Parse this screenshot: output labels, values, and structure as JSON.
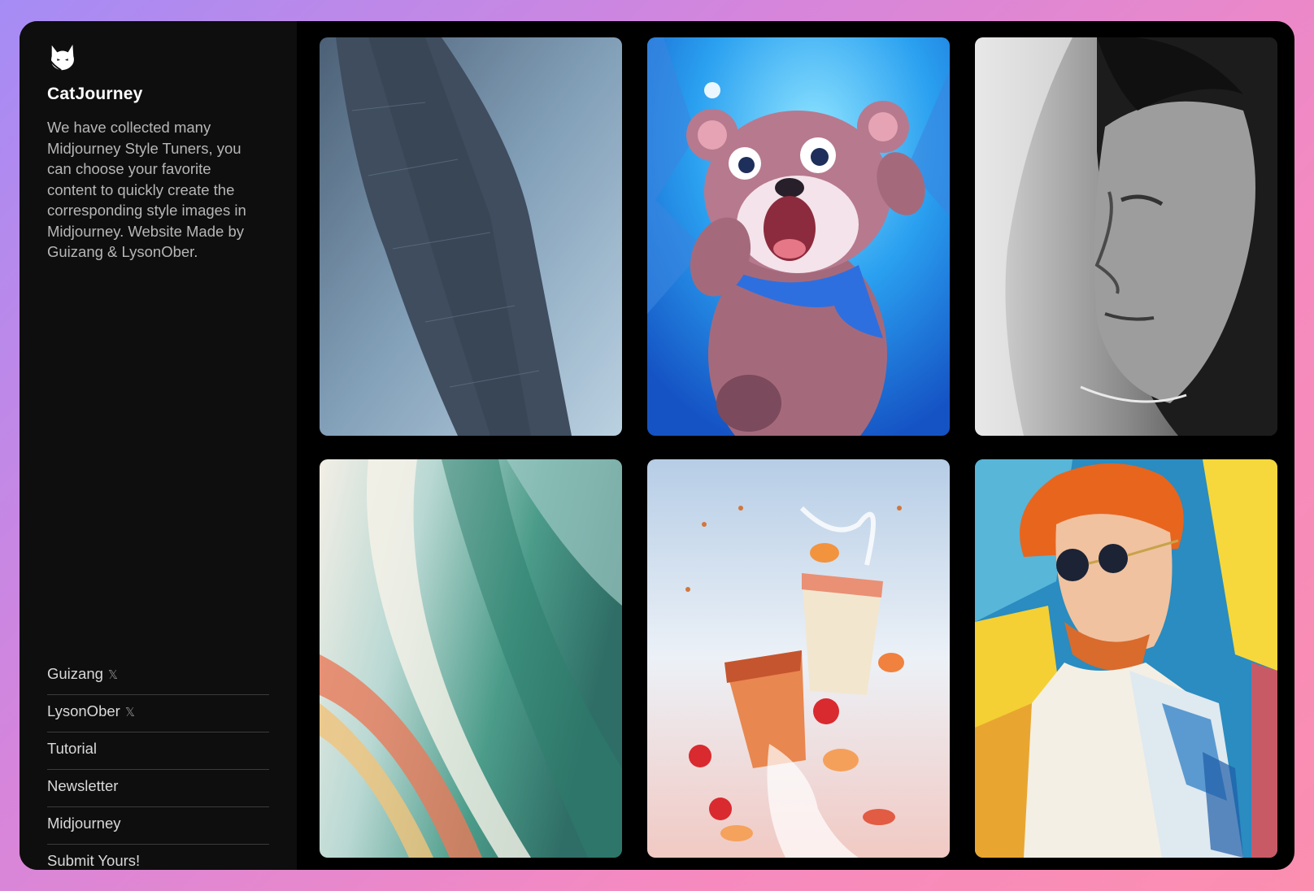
{
  "sidebar": {
    "brand": "CatJourney",
    "description": "We have collected many Midjourney Style Tuners, you can choose your favorite content to quickly create the corresponding style images in Midjourney. Website Made by Guizang & LysonOber.",
    "links": [
      {
        "label": "Guizang",
        "suffix": "𝕏"
      },
      {
        "label": "LysonOber",
        "suffix": "𝕏"
      },
      {
        "label": "Tutorial",
        "suffix": ""
      },
      {
        "label": "Newsletter",
        "suffix": ""
      },
      {
        "label": "Midjourney",
        "suffix": ""
      },
      {
        "label": "Submit Yours!",
        "suffix": ""
      }
    ]
  },
  "gallery": {
    "items": [
      {
        "subject": "sci-fi megastructure in hazy sky"
      },
      {
        "subject": "cartoon bear with blue scarf in snow"
      },
      {
        "subject": "black and white portrait of woman"
      },
      {
        "subject": "abstract teal and pink brush strokes"
      },
      {
        "subject": "peach iced tea splash with fruit"
      },
      {
        "subject": "red-haired man with sunglasses before painted wall"
      }
    ]
  },
  "colors": {
    "background_gradient": [
      "#a58cf5",
      "#f58ac0"
    ],
    "panel": "#000000",
    "sidebar": "#0e0e0e"
  }
}
